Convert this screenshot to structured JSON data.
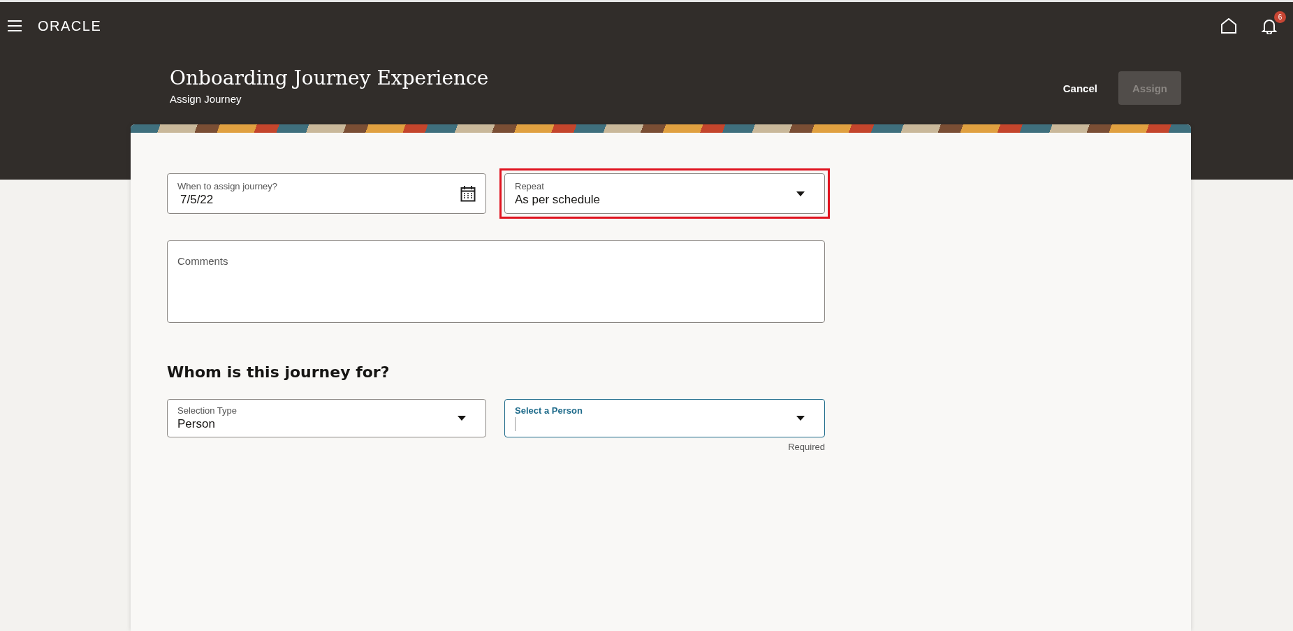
{
  "top_bar": {
    "logo": "ORACLE",
    "notification_count": "6"
  },
  "header": {
    "title": "Onboarding Journey Experience",
    "subtitle": "Assign Journey",
    "buttons": [
      {
        "label": "Cancel",
        "disabled": false
      },
      {
        "label": "Assign",
        "disabled": true
      }
    ]
  },
  "fields": [
    {
      "kind": "date",
      "label": "When to assign journey?",
      "value": "7/5/22",
      "highlighted": false
    },
    {
      "kind": "select",
      "label": "Repeat",
      "value": "As per schedule",
      "highlighted": true
    },
    {
      "kind": "textarea",
      "placeholder": "Comments",
      "highlighted": false
    }
  ],
  "section": {
    "heading": "Whom is this journey for?",
    "fields": [
      {
        "label": "Selection Type",
        "value": "Person",
        "focused": false
      },
      {
        "label": "Select a Person",
        "focused": true,
        "hint": "Required"
      }
    ]
  }
}
